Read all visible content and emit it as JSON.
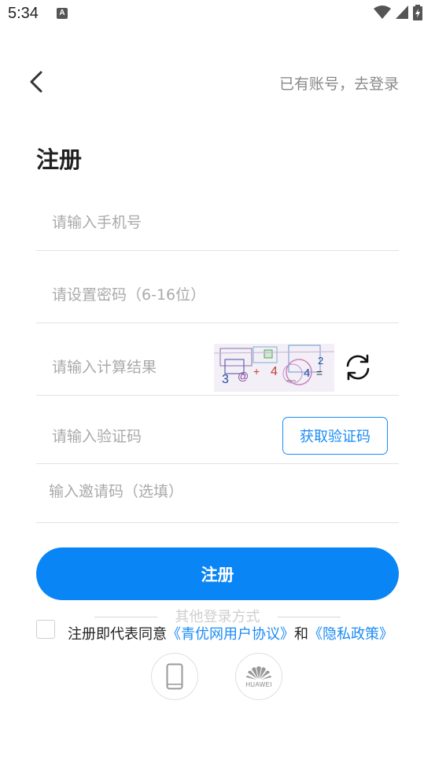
{
  "status_bar": {
    "time": "5:34",
    "notification_icon": "A"
  },
  "header": {
    "back_icon": "chevron-left-icon",
    "login_link": "已有账号，去登录"
  },
  "title": "注册",
  "form": {
    "phone_placeholder": "请输入手机号",
    "password_placeholder": "请设置密码（6-16位）",
    "calc_placeholder": "请输入计算结果",
    "sms_placeholder": "请输入验证码",
    "get_code_button": "获取验证码",
    "invite_placeholder": "输入邀请码（选填）"
  },
  "register_button": "注册",
  "other_login": {
    "label": "其他登录方式",
    "options": [
      {
        "icon": "phone-icon"
      },
      {
        "icon": "huawei-icon",
        "label": "HUAWEI"
      }
    ]
  },
  "agreement": {
    "prefix": "注册即代表同意",
    "user_agreement": "《青优网用户协议》",
    "and": "和",
    "privacy_policy": "《隐私政策》"
  },
  "colors": {
    "accent": "#0a85f5",
    "link": "#1a8cf5",
    "placeholder": "#aaaaaa",
    "divider": "#e2e2e2"
  }
}
